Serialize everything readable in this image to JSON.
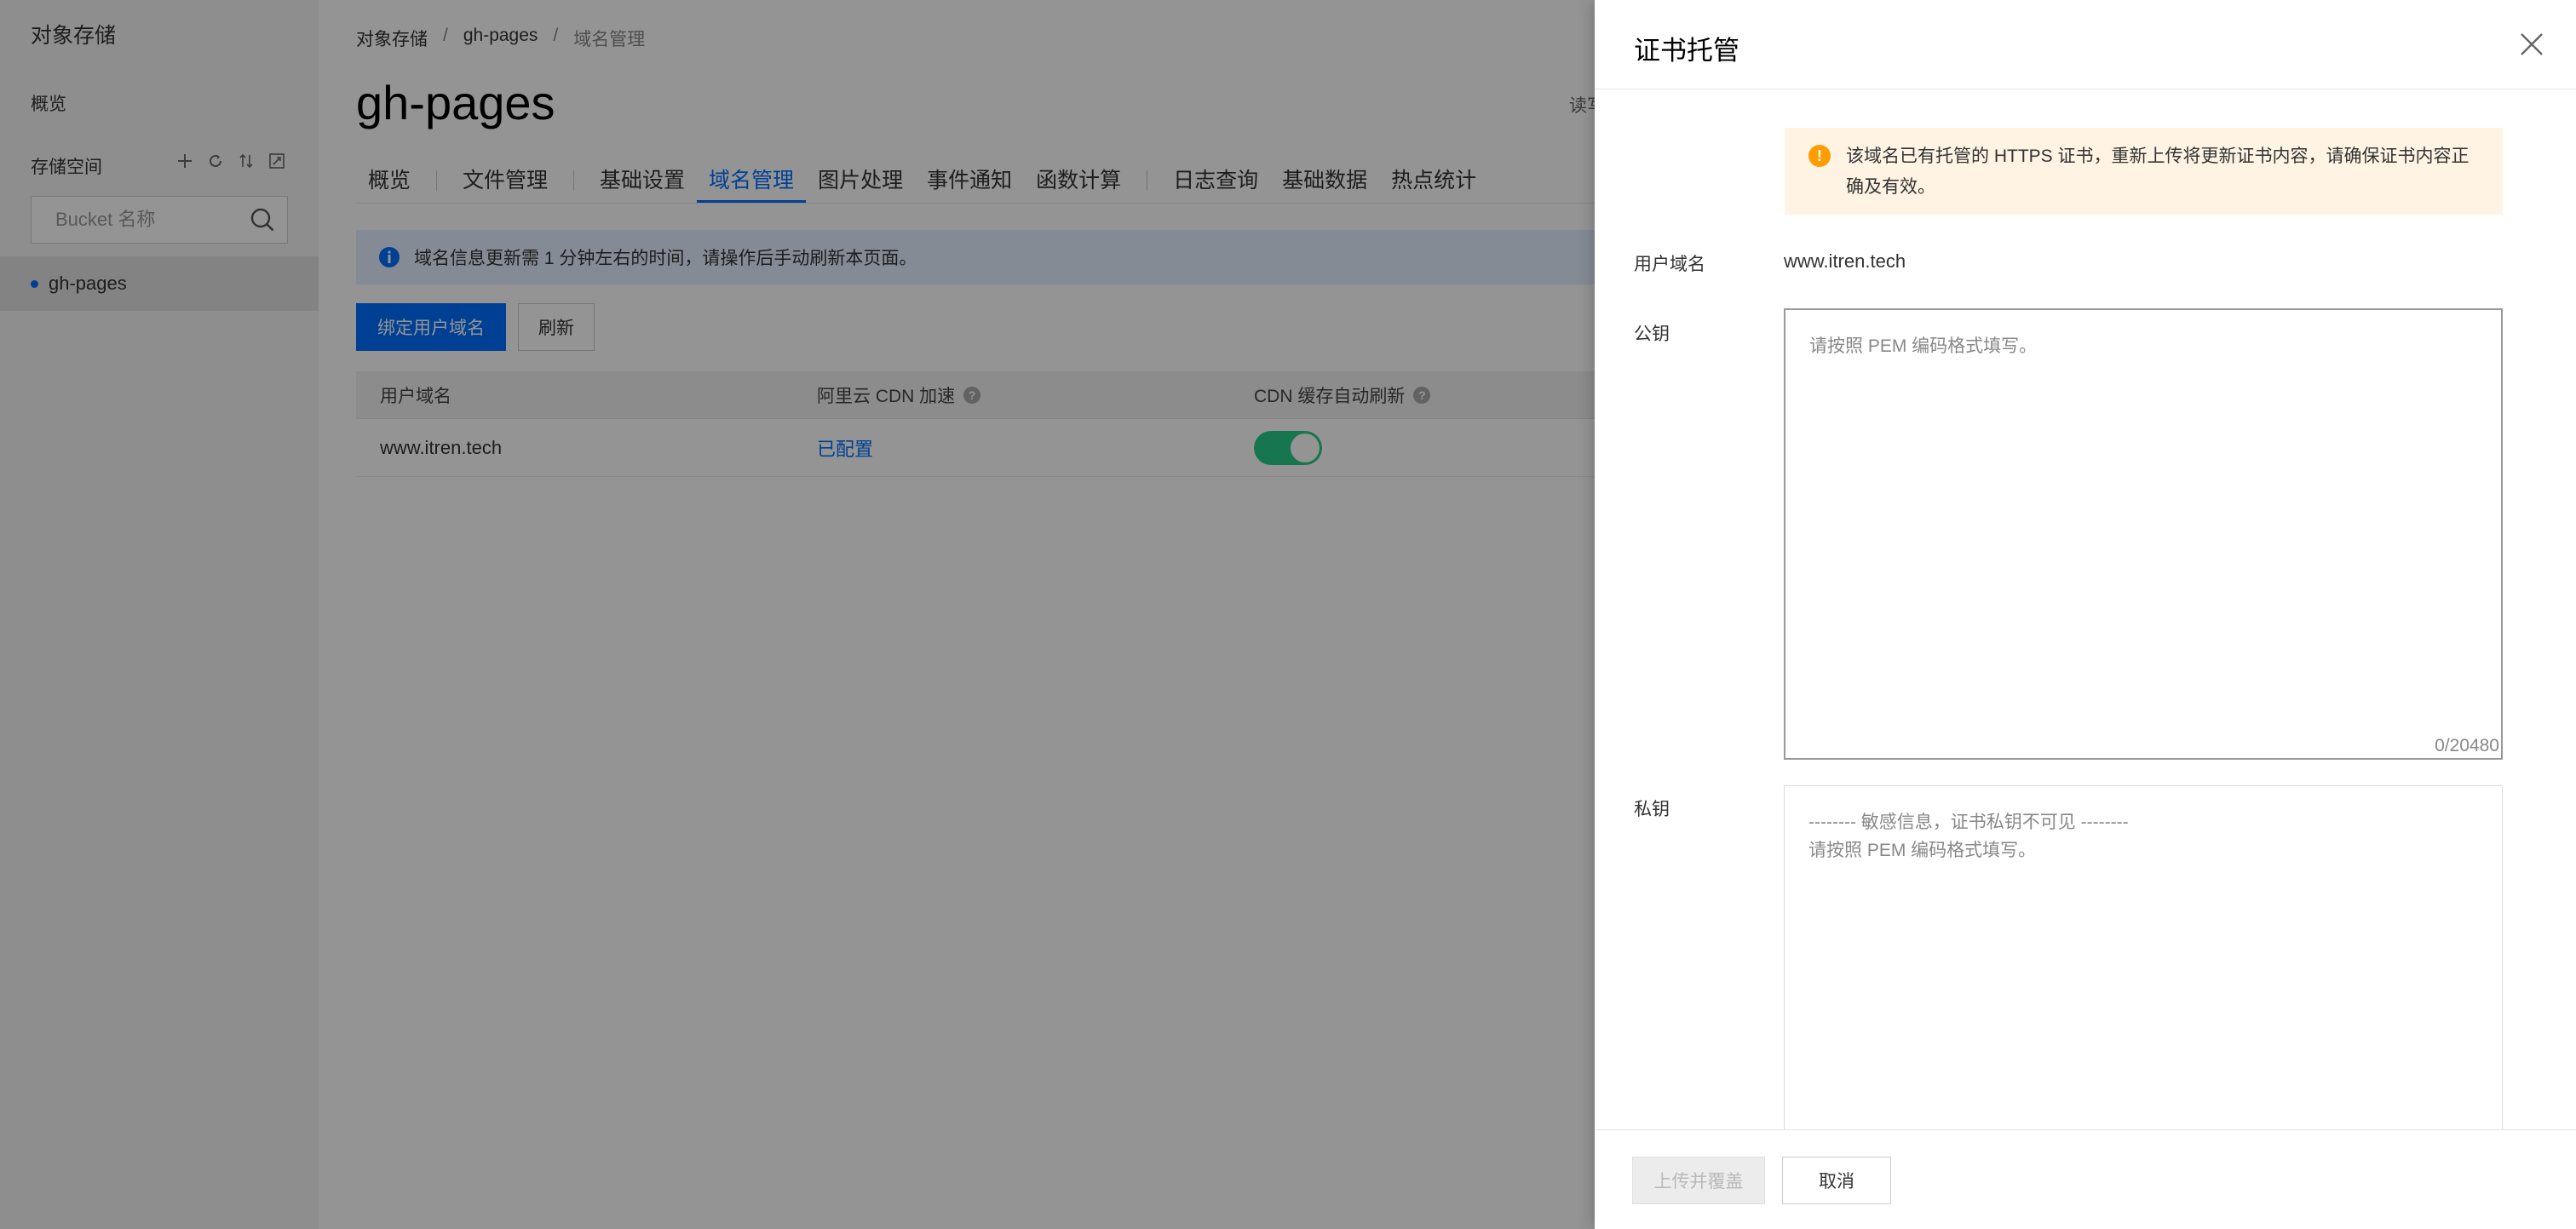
{
  "sidebar": {
    "title": "对象存储",
    "overview": "概览",
    "space_label": "存储空间",
    "tools": [
      "plus-icon",
      "refresh-icon",
      "sort-icon",
      "expand-icon"
    ],
    "search_placeholder": "Bucket 名称",
    "bucket": "gh-pages"
  },
  "main": {
    "breadcrumb": [
      "对象存储",
      "gh-pages",
      "域名管理"
    ],
    "breadcrumb_sep": "/",
    "title": "gh-pages",
    "rw_text": "读写",
    "tabs": [
      "概览",
      "文件管理",
      "基础设置",
      "域名管理",
      "图片处理",
      "事件通知",
      "函数计算",
      "日志查询",
      "基础数据",
      "热点统计"
    ],
    "active_tab": "域名管理",
    "info": "域名信息更新需 1 分钟左右的时间，请操作后手动刷新本页面。",
    "bind_button": "绑定用户域名",
    "refresh_button": "刷新",
    "table": {
      "columns": [
        "用户域名",
        "阿里云 CDN 加速",
        "CDN 缓存自动刷新"
      ],
      "rows": [
        {
          "domain": "www.itren.tech",
          "cdn": "已配置",
          "auto_refresh": true
        }
      ]
    }
  },
  "drawer": {
    "title": "证书托管",
    "warning": "该域名已有托管的 HTTPS 证书，重新上传将更新证书内容，请确保证书内容正确及有效。",
    "domain_label": "用户域名",
    "domain_value": "www.itren.tech",
    "public_key_label": "公钥",
    "public_key_placeholder": "请按照 PEM 编码格式填写。",
    "public_key_counter": "0/20480",
    "private_key_label": "私钥",
    "private_key_placeholder": "-------- 敏感信息，证书私钥不可见 --------\n请按照 PEM 编码格式填写。",
    "upload_button": "上传并覆盖",
    "cancel_button": "取消"
  },
  "colors": {
    "accent": "#006eff",
    "toggle_on": "#29cc85",
    "warning_bg": "#fff4e3",
    "warning_icon": "#ff9d00",
    "info_bg": "#e5f0ff"
  }
}
